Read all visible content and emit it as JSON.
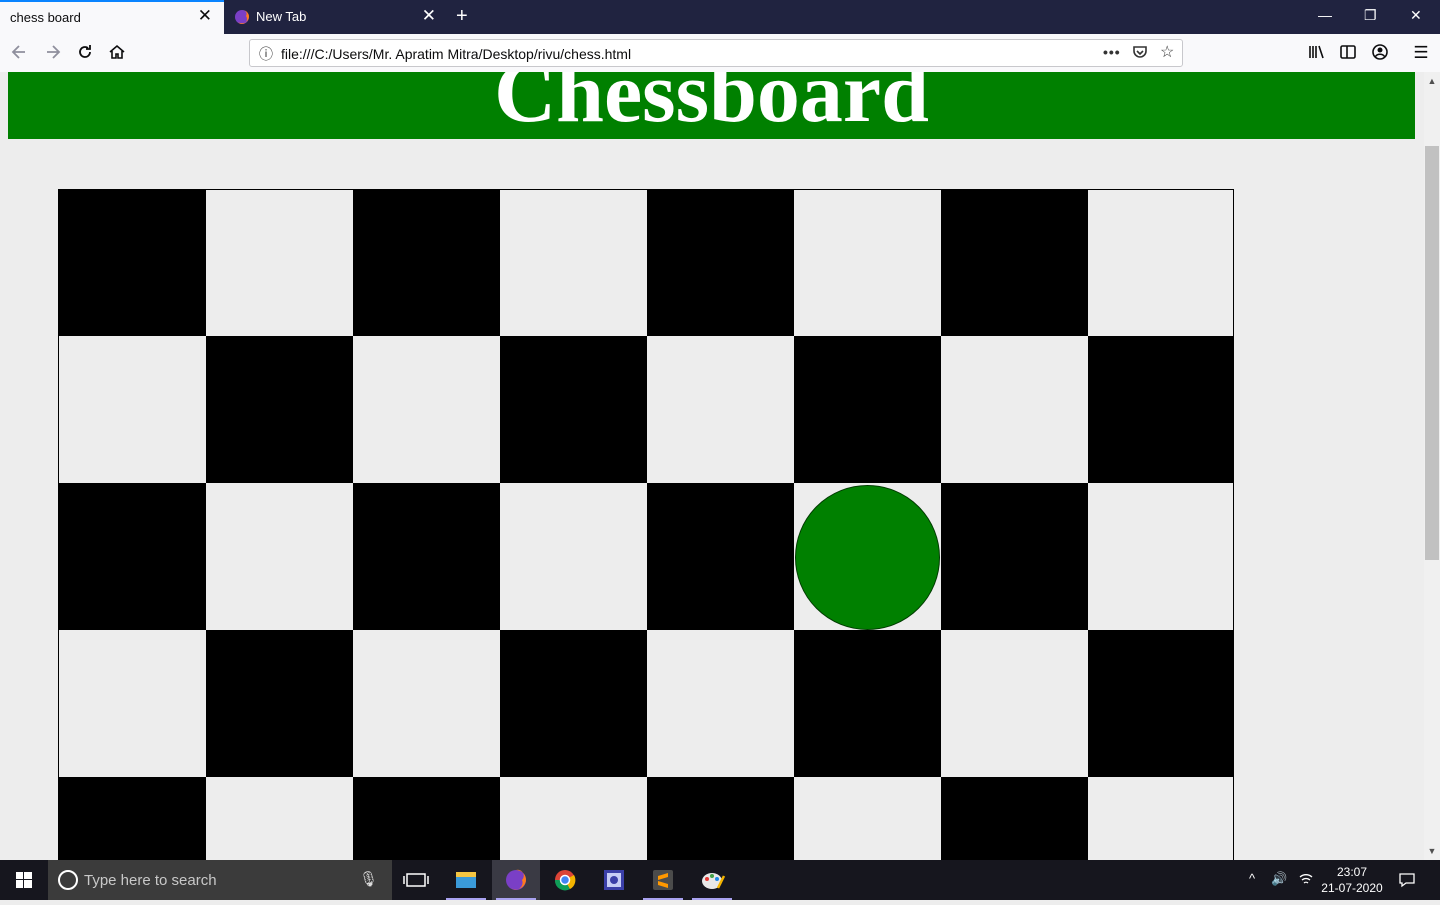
{
  "browser": {
    "tabs": [
      {
        "title": "chess board",
        "active": true
      },
      {
        "title": "New Tab",
        "active": false
      }
    ],
    "url": "file:///C:/Users/Mr. Apratim Mitra/Desktop/rivu/chess.html",
    "icons": {
      "back": "arrow-left-icon",
      "forward": "arrow-right-icon",
      "reload": "reload-icon",
      "home": "home-icon",
      "page_info": "info-icon",
      "page_actions": "more-icon",
      "pocket": "pocket-icon",
      "bookmark": "star-icon",
      "library": "library-icon",
      "sidebar": "sidebar-icon",
      "account": "account-icon",
      "menu": "hamburger-menu-icon"
    }
  },
  "page": {
    "title": "Chessboard",
    "header_color": "#008000",
    "board": {
      "columns": 8,
      "visible_rows": 5,
      "dark_color": "#000000",
      "light_color": "#ededed",
      "top_left_square": "black"
    },
    "piece": {
      "shape": "circle",
      "color": "#008000",
      "row": 3,
      "column": 6
    }
  },
  "taskbar": {
    "search_placeholder": "Type here to search",
    "apps": [
      "task-view",
      "file-explorer",
      "firefox",
      "chrome",
      "settings-app",
      "sublime-text",
      "paint"
    ],
    "time": "23:07",
    "date": "21-07-2020"
  }
}
